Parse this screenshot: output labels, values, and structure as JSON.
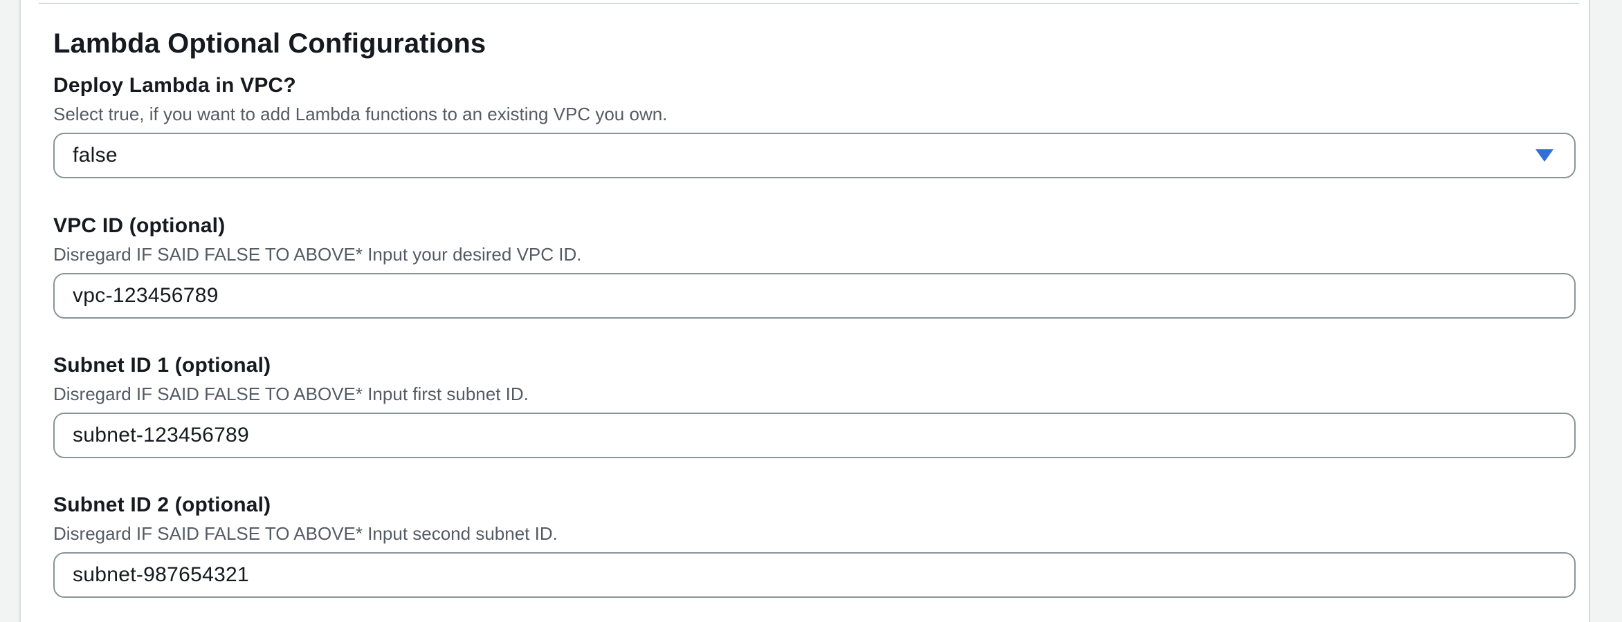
{
  "section": {
    "title": "Lambda Optional Configurations"
  },
  "fields": {
    "deploy_in_vpc": {
      "label": "Deploy Lambda in VPC?",
      "description": "Select true, if you want to add Lambda functions to an existing VPC you own.",
      "value": "false",
      "icon": "caret-down-icon"
    },
    "vpc_id": {
      "label": "VPC ID (optional)",
      "description": "Disregard IF SAID FALSE TO ABOVE* Input your desired VPC ID.",
      "value": "vpc-123456789"
    },
    "subnet_id_1": {
      "label": "Subnet ID 1 (optional)",
      "description": "Disregard IF SAID FALSE TO ABOVE* Input first subnet ID.",
      "value": "subnet-123456789"
    },
    "subnet_id_2": {
      "label": "Subnet ID 2 (optional)",
      "description": "Disregard IF SAID FALSE TO ABOVE* Input second subnet ID.",
      "value": "subnet-987654321"
    }
  },
  "colors": {
    "accent": "#2f6fd6",
    "border": "#879596",
    "text": "#16191f",
    "muted": "#545b64"
  }
}
